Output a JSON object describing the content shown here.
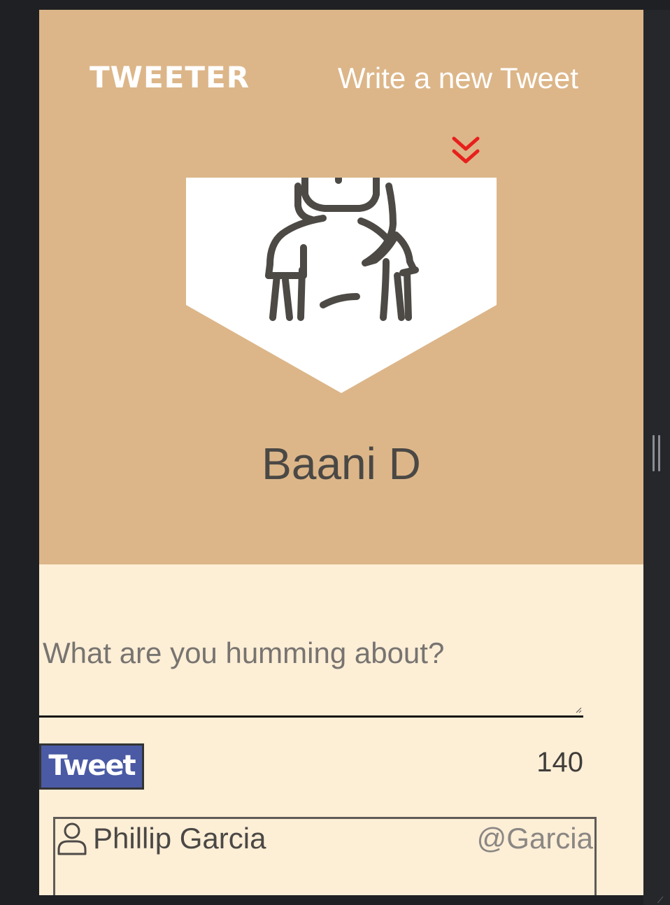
{
  "header": {
    "brand": "TWEETER",
    "write_link": "Write a new Tweet",
    "profile_name": "Baani D"
  },
  "compose": {
    "placeholder": "What are you humming about?",
    "button_label": "Tweet",
    "char_count": "140"
  },
  "tweets": [
    {
      "author": "Phillip Garcia",
      "handle": "@Garcia"
    }
  ],
  "colors": {
    "header_bg": "#dcb689",
    "page_bg": "#fdeed6",
    "button_bg": "#4a5aa4",
    "chevron": "#e8201c"
  }
}
